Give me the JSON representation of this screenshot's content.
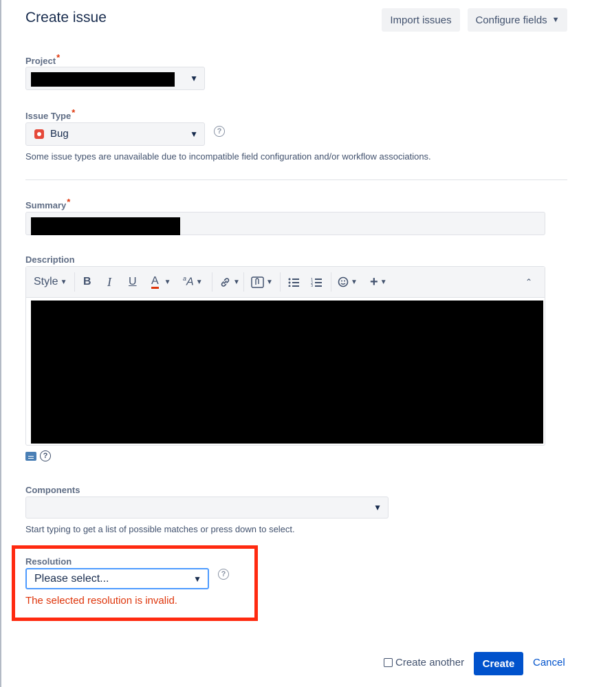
{
  "dialog": {
    "title": "Create issue"
  },
  "header": {
    "import_label": "Import issues",
    "configure_label": "Configure fields"
  },
  "project": {
    "label": "Project",
    "required_mark": "*"
  },
  "issue_type": {
    "label": "Issue Type",
    "required_mark": "*",
    "value": "Bug",
    "hint": "Some issue types are unavailable due to incompatible field configuration and/or workflow associations."
  },
  "summary": {
    "label": "Summary",
    "required_mark": "*"
  },
  "description": {
    "label": "Description",
    "toolbar": {
      "style_label": "Style",
      "bold": "B",
      "italic": "I",
      "underline": "U",
      "text_color": "A"
    }
  },
  "components": {
    "label": "Components",
    "hint": "Start typing to get a list of possible matches or press down to select."
  },
  "resolution": {
    "label": "Resolution",
    "selected": "Please select...",
    "error": "The selected resolution is invalid."
  },
  "footer": {
    "create_another_label": "Create another",
    "create_label": "Create",
    "cancel_label": "Cancel"
  },
  "colors": {
    "primary": "#0052cc",
    "error": "#de350b",
    "highlight_outline": "#ff2a10",
    "bug_icon": "#e5493a"
  }
}
